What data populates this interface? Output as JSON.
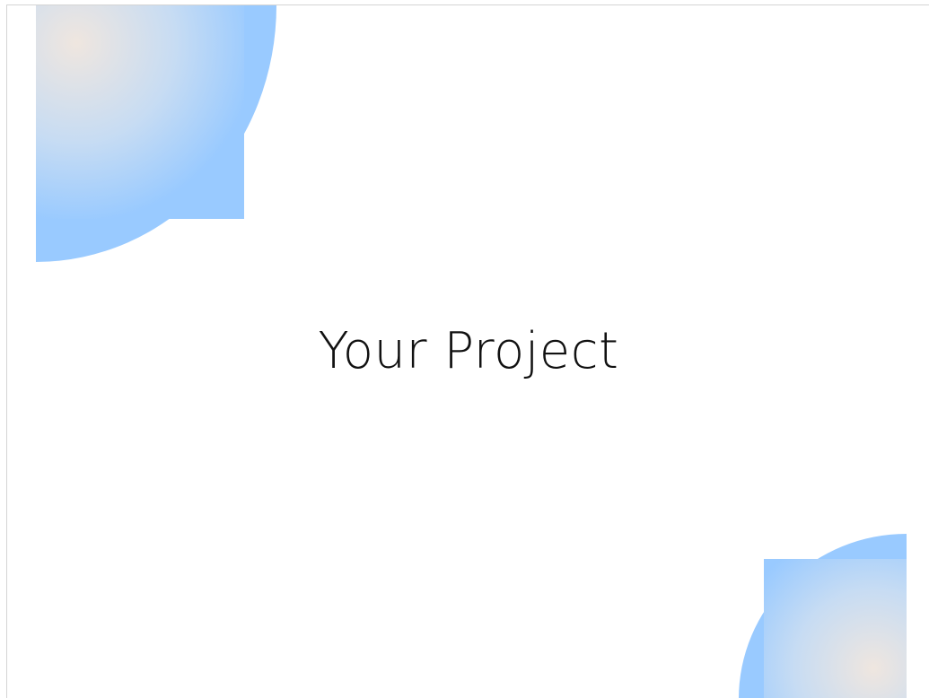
{
  "slide": {
    "title": "Your Project"
  },
  "theme": {
    "accent": "#99caff",
    "glow": "#efe6df",
    "background": "#ffffff",
    "text": "#111111",
    "border": "#d4d4d4"
  }
}
